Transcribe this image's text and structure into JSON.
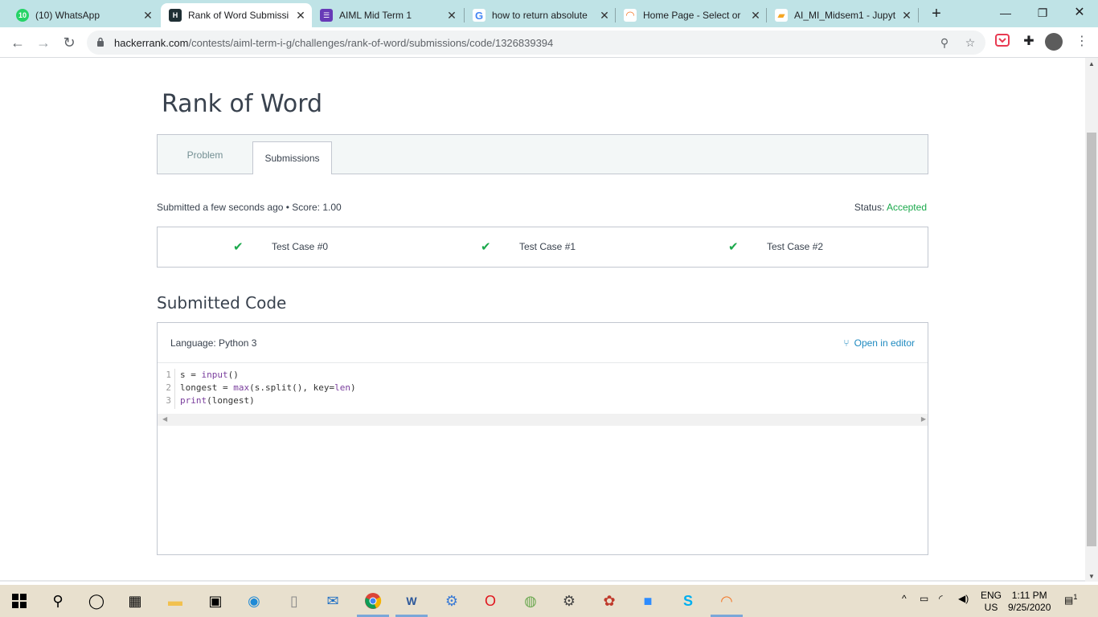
{
  "browser": {
    "tabs": [
      {
        "title": "(10) WhatsApp",
        "badge": "10",
        "color": "#25d366"
      },
      {
        "title": "Rank of Word Submissi",
        "badge": "H",
        "color": "#1f2f34"
      },
      {
        "title": "AIML Mid Term 1",
        "badge": "☰",
        "color": "#673ab7"
      },
      {
        "title": "how to return absolute",
        "badge": "G",
        "color": "#4285f4"
      },
      {
        "title": "Home Page - Select or",
        "badge": "◠",
        "color": "#f37626"
      },
      {
        "title": "AI_MI_Midsem1 - Jupyt",
        "badge": "▰",
        "color": "#f5a623"
      }
    ],
    "url_host": "hackerrank.com",
    "url_path": "/contests/aiml-term-i-g/challenges/rank-of-word/submissions/code/1326839394"
  },
  "page": {
    "title": "Rank of Word",
    "tabs": {
      "problem": "Problem",
      "submissions": "Submissions"
    },
    "meta": "Submitted a few seconds ago • Score: 1.00",
    "status_label": "Status:",
    "status_value": "Accepted",
    "test_cases": [
      "Test Case #0",
      "Test Case #1",
      "Test Case #2"
    ],
    "submitted_code_heading": "Submitted Code",
    "language": "Language: Python 3",
    "open_in_editor": "Open in editor",
    "line_numbers": [
      "1",
      "2",
      "3"
    ]
  },
  "taskbar": {
    "lang_top": "ENG",
    "lang_bottom": "US",
    "time": "1:11 PM",
    "date": "9/25/2020",
    "notification_count": "1"
  }
}
